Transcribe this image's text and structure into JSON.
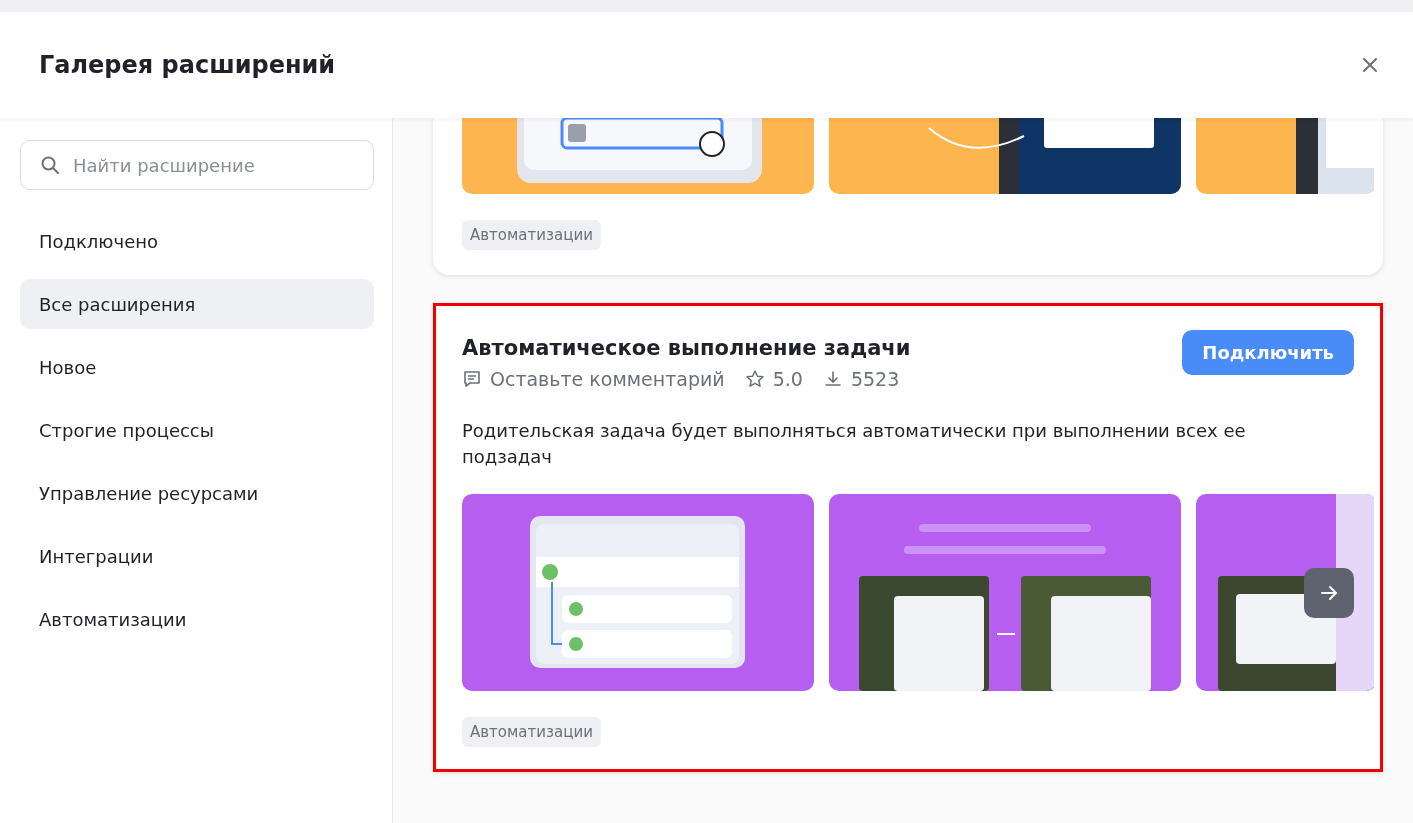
{
  "window": {
    "title": "Галерея расширений"
  },
  "sidebar": {
    "search": {
      "placeholder": "Найти расширение"
    },
    "items": [
      {
        "label": "Подключено",
        "selected": false
      },
      {
        "label": "Все расширения",
        "selected": true
      },
      {
        "label": "Новое",
        "selected": false
      },
      {
        "label": "Строгие процессы",
        "selected": false
      },
      {
        "label": "Управление ресурсами",
        "selected": false
      },
      {
        "label": "Интеграции",
        "selected": false
      },
      {
        "label": "Автоматизации",
        "selected": false
      }
    ]
  },
  "cards": [
    {
      "partial": true,
      "highlighted": false,
      "scroll_button": false,
      "tag": "Автоматизации"
    },
    {
      "partial": false,
      "highlighted": true,
      "scroll_button": true,
      "title": "Автоматическое выполнение задачи",
      "comments": "Оставьте комментарий",
      "rating": "5.0",
      "downloads": "5523",
      "button": "Подключить",
      "description": "Родительская задача будет выполняться автоматически при выполнении всех ее подзадач",
      "tag": "Автоматизации"
    }
  ]
}
